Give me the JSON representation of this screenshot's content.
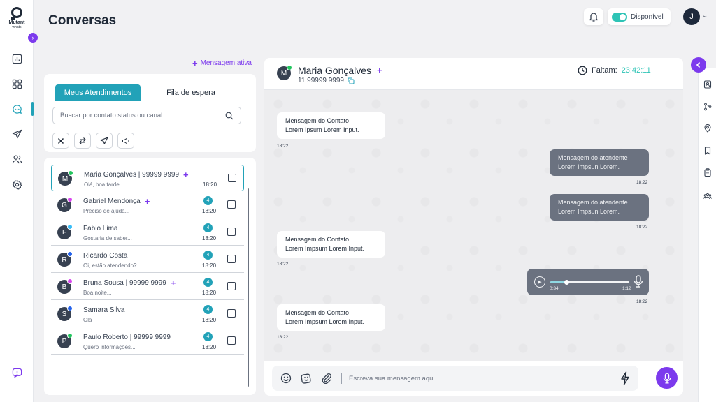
{
  "app": {
    "logo_text": "Mutant",
    "logo_sub": "whats",
    "page_title": "Conversas",
    "availability_label": "Disponível",
    "user_initial": "J"
  },
  "colors": {
    "accent_teal": "#22a2b8",
    "brand_purple": "#7c3aed",
    "online_green": "#22c55e"
  },
  "sidebar": {
    "items": [
      {
        "icon": "chart-icon"
      },
      {
        "icon": "apps-grid-icon"
      },
      {
        "icon": "chat-bubble-icon",
        "active": true
      },
      {
        "icon": "send-icon"
      },
      {
        "icon": "users-icon"
      },
      {
        "icon": "settings-gear-icon"
      },
      {
        "icon": "feedback-icon"
      }
    ]
  },
  "left_panel": {
    "active_message_link": "Mensagem ativa",
    "tabs": [
      "Meus Atendimentos",
      "Fila de espera"
    ],
    "search_placeholder": "Buscar por contato status ou canal",
    "filters": [
      "close-icon",
      "transfer-icon",
      "send-icon",
      "megaphone-icon"
    ]
  },
  "contacts": [
    {
      "initial": "M",
      "name": "Maria Gonçalves | 99999 9999",
      "plus": true,
      "preview": "Olá, boa tarde...",
      "time": "18:20",
      "badge": "",
      "channel": "whatsapp",
      "channel_color": "#22c55e",
      "selected": true
    },
    {
      "initial": "G",
      "name": "Gabriel Mendonça",
      "plus": true,
      "preview": "Preciso de ajuda...",
      "time": "18:20",
      "badge": "4",
      "channel": "instagram",
      "channel_color": "#d946ef",
      "selected": false
    },
    {
      "initial": "F",
      "name": "Fabio Lima",
      "plus": false,
      "preview": "Gostaria de saber...",
      "time": "18:20",
      "badge": "4",
      "channel": "telegram",
      "channel_color": "#38bdf8",
      "selected": false
    },
    {
      "initial": "R",
      "name": "Ricardo Costa",
      "plus": false,
      "preview": "Oi, estão atendendo?...",
      "time": "18:20",
      "badge": "4",
      "channel": "facebook",
      "channel_color": "#2563eb",
      "selected": false
    },
    {
      "initial": "B",
      "name": "Bruna Sousa | 99999 9999",
      "plus": true,
      "preview": "Boa noite...",
      "time": "18:20",
      "badge": "4",
      "channel": "instagram",
      "channel_color": "#d946ef",
      "selected": false
    },
    {
      "initial": "S",
      "name": "Samara Silva",
      "plus": false,
      "preview": "Olá",
      "time": "18:20",
      "badge": "4",
      "channel": "facebook",
      "channel_color": "#2563eb",
      "selected": false
    },
    {
      "initial": "P",
      "name": "Paulo Roberto | 99999 9999",
      "plus": false,
      "preview": "Quero informações...",
      "time": "18:20",
      "badge": "4",
      "channel": "whatsapp",
      "channel_color": "#22c55e",
      "selected": false
    }
  ],
  "chat": {
    "contact_initial": "M",
    "contact_name": "Maria Gonçalves",
    "contact_phone": "11 99999 9999",
    "timer_label": "Faltam:",
    "timer_value": "23:42:11",
    "messages": [
      {
        "dir": "in",
        "line1": "Mensagem do Contato",
        "line2": "Lorem Ipsum Lorem Input.",
        "time": "18:22"
      },
      {
        "dir": "out",
        "line1": "Mensagem do atendente",
        "line2": "Lorem Impsun Lorem.",
        "time": "18:22"
      },
      {
        "dir": "out",
        "line1": "Mensagem do atendente",
        "line2": "Lorem Impsun Lorem.",
        "time": "18:22"
      },
      {
        "dir": "in",
        "line1": "Mensagem do Contato",
        "line2": "Lorem Impsum Lorem Input.",
        "time": "18:22"
      },
      {
        "dir": "in",
        "line1": "Mensagem do Contato",
        "line2": "Lorem Impsum Lorem Input.",
        "time": "18:22"
      }
    ],
    "audio": {
      "current": "0:34",
      "total": "1:12",
      "progress": 0.2,
      "time": "18:22"
    },
    "composer_placeholder": "Escreva sua mensagem aqui....."
  },
  "right_rail": {
    "icons": [
      "toggle-chevron-icon",
      "id-card-icon",
      "branch-icon",
      "location-pin-icon",
      "bookmark-icon",
      "clipboard-icon",
      "group-icon"
    ]
  }
}
